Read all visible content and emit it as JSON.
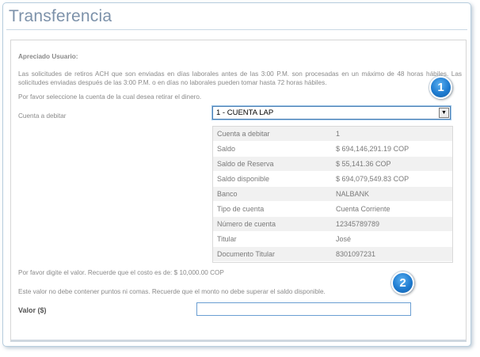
{
  "page": {
    "title": "Transferencia"
  },
  "info": {
    "greeting": "Apreciado Usuario:",
    "paragraph": "Las solicitudes de retiros ACH que son enviadas en días laborales antes de las 3:00 P.M. son procesadas en un máximo de 48 horas hábiles. Las solicitudes enviadas después de las 3:00 P.M. o en días no laborales pueden tomar hasta 72 horas hábiles.",
    "select_prompt": "Por favor seleccione la cuenta de la cual desea retirar el dinero."
  },
  "account": {
    "label": "Cuenta a debitar",
    "selected": "1 - CUENTA LAP"
  },
  "details": [
    {
      "key": "Cuenta a debitar",
      "value": "1"
    },
    {
      "key": "Saldo",
      "value": "$ 694,146,291.19 COP"
    },
    {
      "key": "Saldo de Reserva",
      "value": "$ 55,141.36 COP"
    },
    {
      "key": "Saldo disponible",
      "value": "$ 694,079,549.83 COP"
    },
    {
      "key": "Banco",
      "value": "NALBANK"
    },
    {
      "key": "Tipo de cuenta",
      "value": "Cuenta Corriente"
    },
    {
      "key": "Número de cuenta",
      "value": "12345789789"
    },
    {
      "key": "Titular",
      "value": "José"
    },
    {
      "key": "Documento Titular",
      "value": "8301097231"
    }
  ],
  "amount": {
    "note_cost": "Por favor digite el valor. Recuerde que el costo es de: $ 10,000.00 COP",
    "note_format": "Este valor no debe contener puntos ni comas. Recuerde que el monto no debe superar el saldo disponible.",
    "label": "Valor ($)",
    "value": "",
    "placeholder": ""
  },
  "badges": {
    "one": "1",
    "two": "2"
  },
  "colors": {
    "title": "#7d92aa",
    "badge": "#1e7bd0",
    "input_border": "#6a9ed2"
  }
}
